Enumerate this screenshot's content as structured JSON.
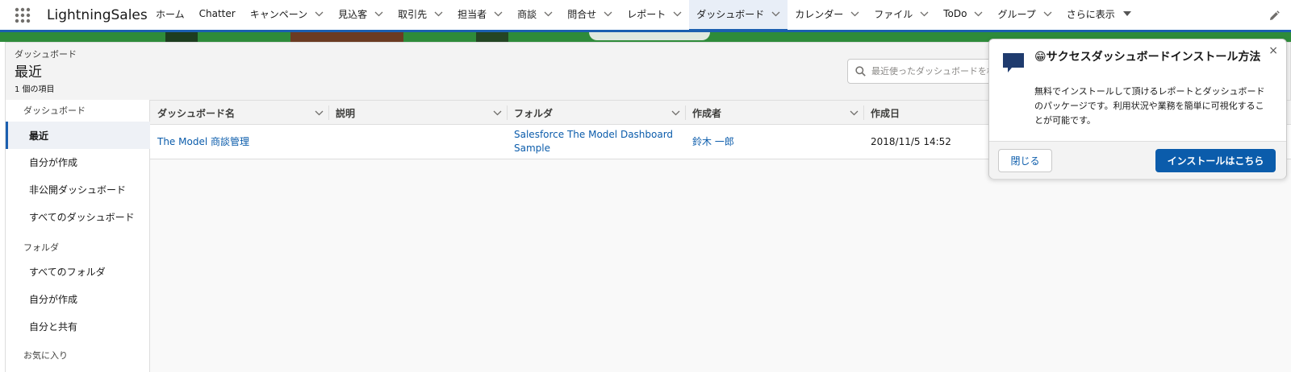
{
  "app": {
    "name": "LightningSales"
  },
  "nav": {
    "items": [
      {
        "label": "ホーム",
        "chevron": false
      },
      {
        "label": "Chatter",
        "chevron": false
      },
      {
        "label": "キャンペーン",
        "chevron": true
      },
      {
        "label": "見込客",
        "chevron": true
      },
      {
        "label": "取引先",
        "chevron": true
      },
      {
        "label": "担当者",
        "chevron": true
      },
      {
        "label": "商談",
        "chevron": true
      },
      {
        "label": "問合せ",
        "chevron": true
      },
      {
        "label": "レポート",
        "chevron": true
      },
      {
        "label": "ダッシュボード",
        "chevron": true,
        "active": true
      },
      {
        "label": "カレンダー",
        "chevron": true
      },
      {
        "label": "ファイル",
        "chevron": true
      },
      {
        "label": "ToDo",
        "chevron": true
      },
      {
        "label": "グループ",
        "chevron": true
      }
    ],
    "more_label": "さらに表示"
  },
  "header": {
    "breadcrumb": "ダッシュボード",
    "title": "最近",
    "item_count": "1 個の項目",
    "search_placeholder": "最近使ったダッシュボードを検索..."
  },
  "sidebar": {
    "section_dashboards": "ダッシュボード",
    "items_dashboards": [
      "最近",
      "自分が作成",
      "非公開ダッシュボード",
      "すべてのダッシュボード"
    ],
    "section_folders": "フォルダ",
    "items_folders": [
      "すべてのフォルダ",
      "自分が作成",
      "自分と共有"
    ],
    "section_favorites": "お気に入り"
  },
  "table": {
    "columns": [
      "ダッシュボード名",
      "説明",
      "フォルダ",
      "作成者",
      "作成日"
    ],
    "rows": [
      {
        "name": "The Model 商談管理",
        "description": "",
        "folder": "Salesforce The Model Dashboard Sample",
        "created_by": "鈴木 一郎",
        "created_date": "2018/11/5 14:52"
      }
    ]
  },
  "popover": {
    "title": "😁サクセスダッシュボードインストール方法",
    "body": "無料でインストールして頂けるレポートとダッシュボードのパッケージです。利用状況や業務を簡単に可視化することが可能です。",
    "close_label": "閉じる",
    "install_label": "インストールはこちら",
    "close_icon": "×"
  },
  "colors": {
    "brand": "#1b5fb0",
    "link": "#0b5cab",
    "button_primary": "#0b5cab"
  }
}
